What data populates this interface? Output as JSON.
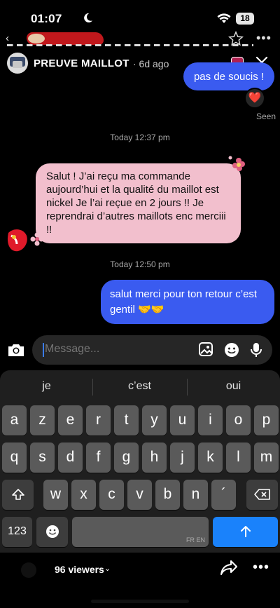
{
  "status_bar": {
    "time": "01:07",
    "battery": "18"
  },
  "story": {
    "username": "PREUVE MAILLOT",
    "posted_ago": "· 6d ago",
    "viewers": "96 viewers"
  },
  "chat": {
    "messages": [
      {
        "from": "me",
        "text": "pas de soucis !",
        "reaction": "❤️"
      },
      {
        "from": "them",
        "text": "Salut ! J’ai reçu ma commande aujourd’hui et la qualité du maillot est nickel Je l’ai reçue en 2 jours !! Je reprendrai d’autres maillots enc merciii !!"
      },
      {
        "from": "me",
        "text": "salut merci pour ton retour c’est gentil 🤝🤝"
      }
    ],
    "seen_label": "Seen",
    "timestamps": [
      "Today 12:37 pm",
      "Today 12:50 pm"
    ]
  },
  "composer": {
    "placeholder": "Message..."
  },
  "keyboard": {
    "suggestions": [
      "je",
      "c’est",
      "oui"
    ],
    "row1": [
      "a",
      "z",
      "e",
      "r",
      "t",
      "y",
      "u",
      "i",
      "o",
      "p"
    ],
    "row2": [
      "q",
      "s",
      "d",
      "f",
      "g",
      "h",
      "j",
      "k",
      "l",
      "m"
    ],
    "row3": [
      "w",
      "x",
      "c",
      "v",
      "b",
      "n",
      "´"
    ],
    "numbers_key": "123",
    "space_label": "FR EN",
    "emoji_key": "emoji-icon",
    "return_key": "send-arrow-icon"
  },
  "colors": {
    "outgoing_bubble": "#3a5bf0",
    "incoming_bubble": "#f2bfcd",
    "send_key": "#1a82fb"
  }
}
